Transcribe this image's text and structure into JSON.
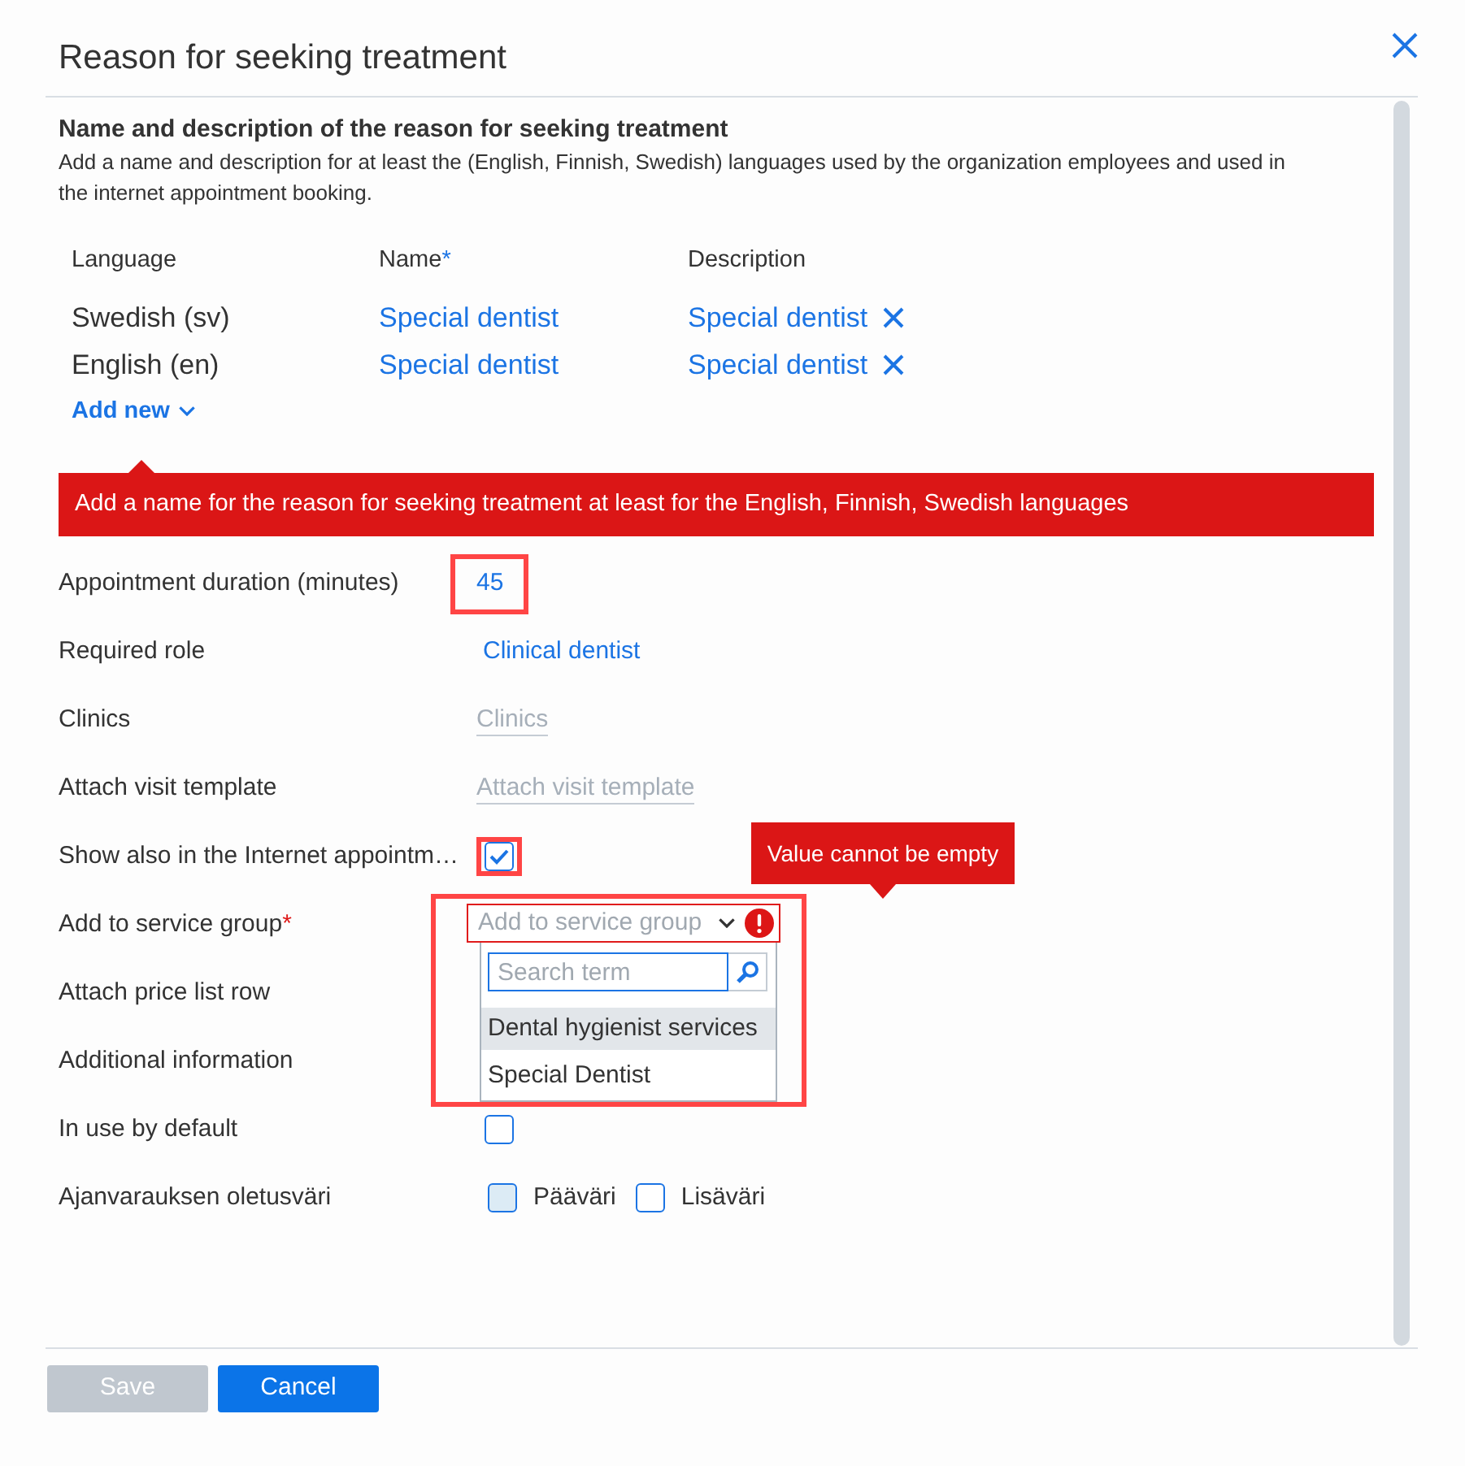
{
  "dialog": {
    "title": "Reason for seeking treatment"
  },
  "section": {
    "heading": "Name and description of the reason for seeking treatment",
    "description": "Add a name and description for at least the (English, Finnish, Swedish) languages used by the organization employees and used in the internet appointment booking."
  },
  "translations": {
    "columns": [
      {
        "label": "Language"
      },
      {
        "label": "Name",
        "marker": "*"
      },
      {
        "label": "Description"
      }
    ],
    "rows": [
      {
        "language": "Swedish (sv)",
        "name": "Special dentist",
        "description": "Special dentist"
      },
      {
        "language": "English (en)",
        "name": "Special dentist",
        "description": "Special dentist"
      }
    ],
    "add_new": "Add new"
  },
  "error_banner": "Add a name for the reason for seeking treatment at least for the English, Finnish, Swedish languages",
  "fields": [
    {
      "kind": "value",
      "label": "Appointment duration (minutes)",
      "value": "45",
      "highlighted": true
    },
    {
      "kind": "value",
      "label": "Required role",
      "value": "Clinical dentist"
    },
    {
      "kind": "picker",
      "label": "Clinics",
      "placeholder": "Clinics"
    },
    {
      "kind": "picker",
      "label": "Attach visit template",
      "placeholder": "Attach visit template"
    },
    {
      "kind": "checkbox",
      "label": "Show also in the Internet appointm…",
      "checked": true,
      "highlighted": true
    },
    {
      "kind": "select",
      "label": "Add to service group",
      "marker": "*",
      "placeholder": "Add to service group",
      "invalid": true,
      "expanded": true,
      "highlighted": true,
      "error": "Value cannot be empty",
      "dropdown": {
        "search_placeholder": "Search term",
        "options": [
          {
            "label": "Dental hygienist services",
            "selected": true
          },
          {
            "label": "Special Dentist",
            "selected": false
          }
        ]
      }
    },
    {
      "kind": "blank",
      "label": "Attach price list row"
    },
    {
      "kind": "blank",
      "label": "Additional information"
    },
    {
      "kind": "checkbox",
      "label": "In use by default",
      "checked": false
    },
    {
      "kind": "swatches",
      "label": "Ajanvarauksen oletusväri",
      "options": [
        {
          "label": "Pääväri",
          "color": "#dcebf5"
        },
        {
          "label": "Lisäväri",
          "color": "#ffffff"
        }
      ]
    }
  ],
  "buttons": [
    {
      "label": "Save",
      "disabled": true
    },
    {
      "label": "Cancel",
      "disabled": false
    }
  ]
}
